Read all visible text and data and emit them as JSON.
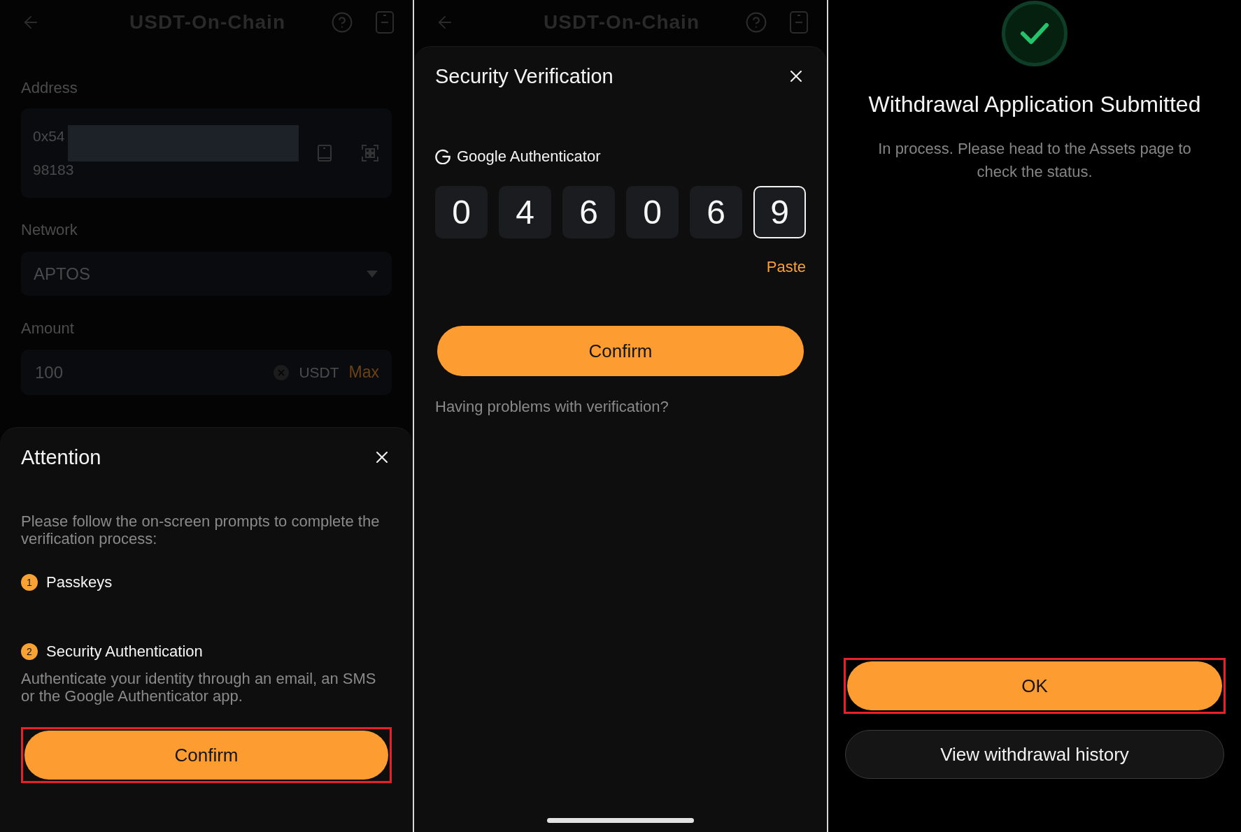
{
  "panels": [
    {
      "kind": "attention",
      "page": {
        "title": "USDT-On-Chain",
        "fields": [
          {
            "kind": "address",
            "label": "Address",
            "value_start": "0x54",
            "value_end": "98183",
            "redacted": true
          },
          {
            "kind": "select",
            "label": "Network",
            "value": "APTOS"
          },
          {
            "kind": "amount",
            "label": "Amount",
            "value": "100",
            "unit": "USDT",
            "action": "Max"
          }
        ]
      },
      "sheet": {
        "title": "Attention",
        "intro": "Please follow the on-screen prompts to complete the verification process:",
        "steps": [
          {
            "number": "1",
            "title": "Passkeys"
          },
          {
            "number": "2",
            "title": "Security Authentication",
            "description": "Authenticate your identity through an email, an SMS or the Google Authenticator app."
          }
        ],
        "button": {
          "label": "Confirm",
          "highlighted": true
        }
      }
    },
    {
      "kind": "verification",
      "page": {
        "title": "USDT-On-Chain"
      },
      "sheet": {
        "title": "Security Verification",
        "method": "Google Authenticator",
        "code": [
          {
            "digit": "0",
            "selected": false
          },
          {
            "digit": "4",
            "selected": false
          },
          {
            "digit": "6",
            "selected": false
          },
          {
            "digit": "0",
            "selected": false
          },
          {
            "digit": "6",
            "selected": false
          },
          {
            "digit": "9",
            "selected": true
          }
        ],
        "paste": "Paste",
        "button": {
          "label": "Confirm",
          "highlighted": false
        },
        "help_link": "Having problems with verification?"
      }
    },
    {
      "kind": "result",
      "title": "Withdrawal Application Submitted",
      "message": "In process. Please head to the Assets page to check the status.",
      "buttons": [
        {
          "kind": "primary",
          "label": "OK",
          "highlighted": true
        },
        {
          "kind": "secondary",
          "label": "View withdrawal history",
          "highlighted": false
        }
      ]
    }
  ]
}
